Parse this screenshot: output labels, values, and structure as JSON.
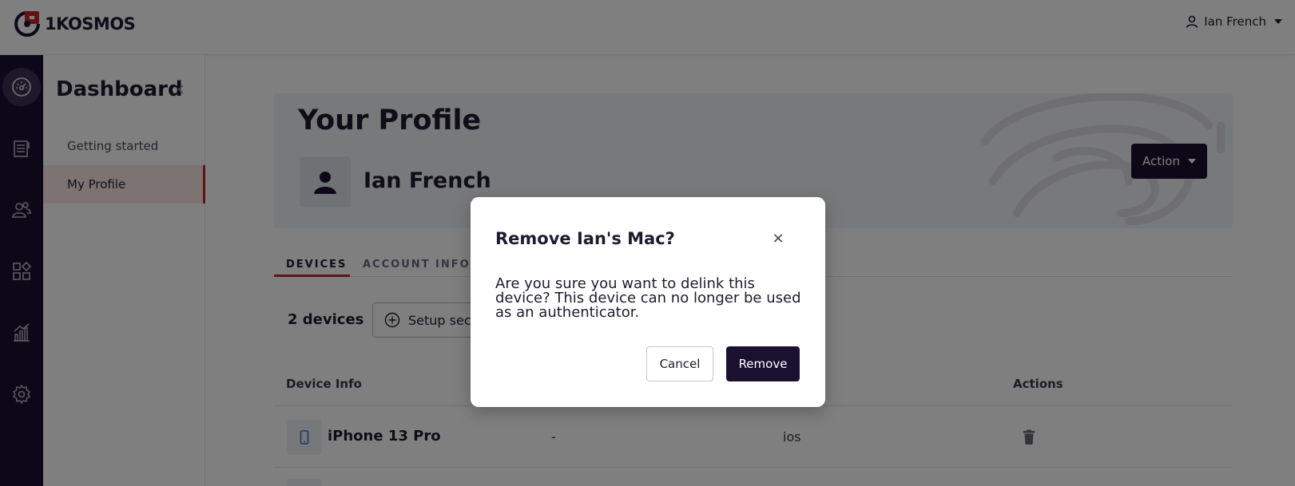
{
  "header": {
    "logo_text": "1KOSMOS",
    "user_name": "Ian French"
  },
  "rail": {
    "items": [
      "dashboard-icon",
      "directory-icon",
      "users-icon",
      "apps-icon",
      "reports-icon",
      "settings-icon"
    ]
  },
  "sidebar": {
    "title": "Dashboard",
    "items": [
      {
        "label": "Getting started",
        "active": false
      },
      {
        "label": "My Profile",
        "active": true
      }
    ]
  },
  "profile": {
    "title": "Your Profile",
    "name": "Ian French",
    "action_label": "Action"
  },
  "tabs": [
    {
      "label": "DEVICES",
      "active": true
    },
    {
      "label": "ACCOUNT INFORM",
      "active": false
    }
  ],
  "devices": {
    "count_label": "2 devices",
    "setup_label": "Setup secu",
    "columns": [
      "Device Info",
      "Actions"
    ],
    "rows": [
      {
        "name": "iPhone 13 Pro",
        "col2": "-",
        "col3": "ios"
      }
    ]
  },
  "modal": {
    "title": "Remove Ian's Mac?",
    "close_glyph": "×",
    "body": "Are you sure you want to delink this device? This device can no longer be used as an authenticator.",
    "cancel_label": "Cancel",
    "remove_label": "Remove"
  },
  "colors": {
    "brand_dark": "#1a1130",
    "brand_red": "#c0282d",
    "active_bg": "#fde6e6"
  }
}
